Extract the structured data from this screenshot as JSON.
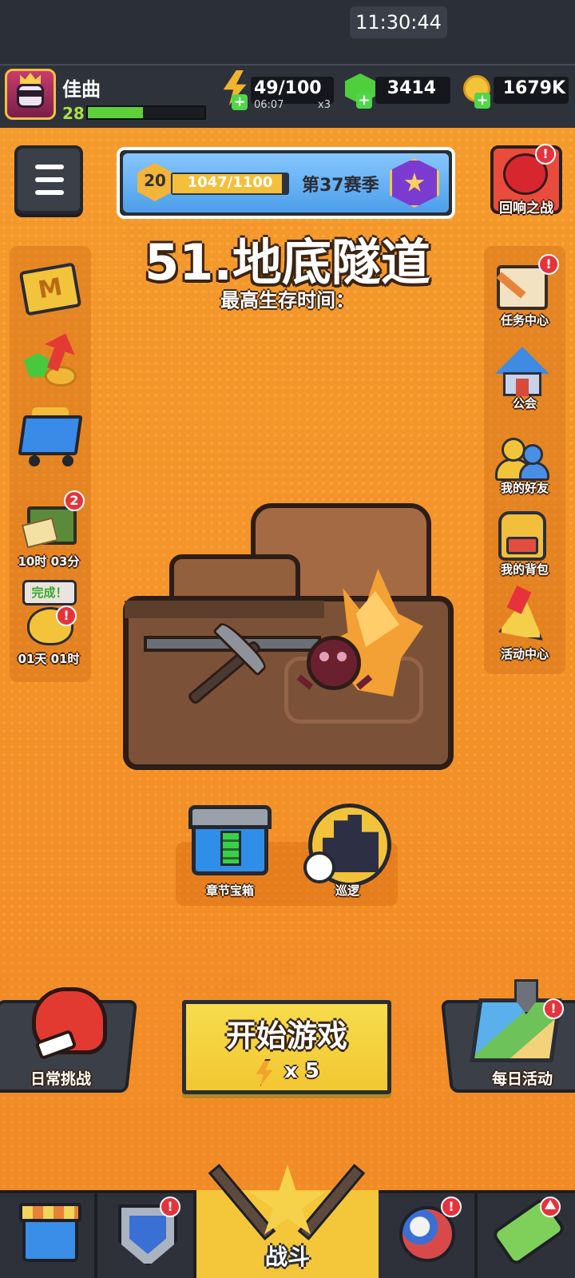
{
  "status_bar": {
    "time": "11:30:44"
  },
  "player": {
    "name": "佳曲",
    "level": "28",
    "xp_fraction": 0.47
  },
  "resources": {
    "energy": {
      "value": "49/100",
      "timer": "06:07",
      "multiplier": "x3",
      "icon": "lightning-bolt-icon"
    },
    "gems": {
      "value": "3414",
      "icon": "green-gem-icon"
    },
    "coins": {
      "value": "1679K",
      "icon": "gold-coin-icon"
    },
    "plus_glyph": "+"
  },
  "season": {
    "level": "20",
    "xp": "1047/1100",
    "xp_fraction": 0.952,
    "name": "第37赛季"
  },
  "echo_battle": {
    "label": "回响之战",
    "badge": "!"
  },
  "level": {
    "title": "51.地底隧道",
    "best_time_label": "最高生存时间："
  },
  "left_sidebar": {
    "monthly_card": {
      "letter": "M"
    },
    "loot_crate": {
      "badge": "2",
      "timer": "10时 03分"
    },
    "piggy_bank": {
      "bubble": "完成！",
      "badge": "!",
      "timer": "01天 01时"
    }
  },
  "right_sidebar": {
    "items": [
      {
        "label": "任务中心",
        "badge": "!"
      },
      {
        "label": "公会"
      },
      {
        "label": "我的好友"
      },
      {
        "label": "我的背包"
      },
      {
        "label": "活动中心"
      }
    ]
  },
  "chapter": {
    "chest_label": "章节宝箱",
    "patrol_label": "巡逻"
  },
  "actions": {
    "daily_challenge": "日常挑战",
    "start_game": "开始游戏",
    "start_cost": "x 5",
    "daily_event": "每日活动",
    "daily_event_badge": "!"
  },
  "bottom_nav": {
    "battle_label": "战斗",
    "shield_badge": "!",
    "balls_badge": "!"
  },
  "colors": {
    "background_orange": "#f59a2c",
    "panel_dark": "#3b3f48",
    "accent_yellow": "#f4c63a",
    "badge_red": "#e6333b",
    "xp_green": "#5ed03a"
  }
}
